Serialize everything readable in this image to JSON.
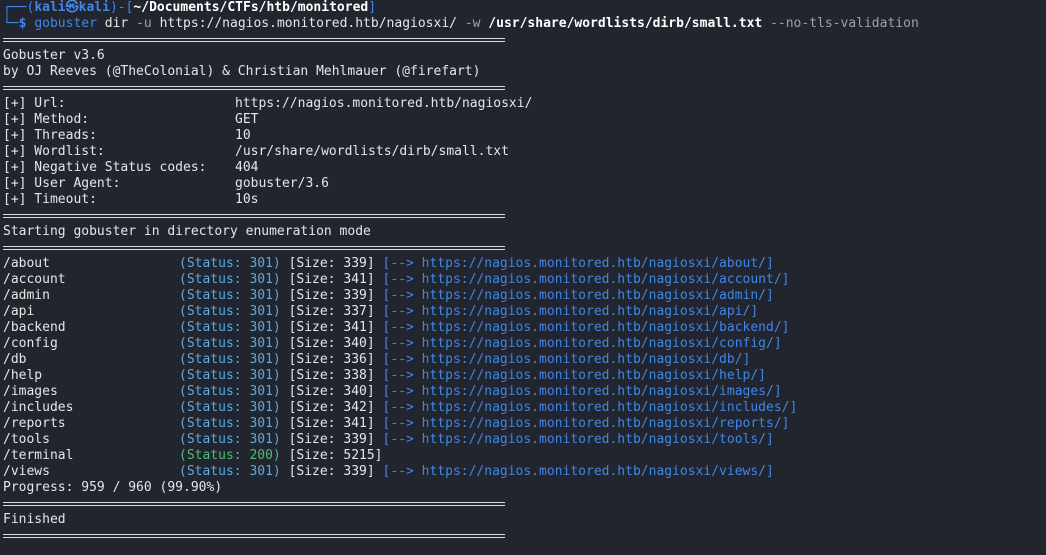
{
  "prompt": {
    "corner_top": "┌──(",
    "user": "kali㉿kali",
    "mid": ")-[",
    "cwd": "~/Documents/CTFs/htb/monitored",
    "close": "]",
    "corner_bottom": "└─",
    "dollar": "$ ",
    "cmd_tool": "gobuster",
    "cmd_sub": "dir",
    "flag_u": "-u",
    "url": "https://nagios.monitored.htb/nagiosxi/",
    "flag_w": "-w",
    "wordlist": "/usr/share/wordlists/dirb/small.txt",
    "flag_tls": "--no-tls-validation"
  },
  "banner": {
    "version": "Gobuster v3.6",
    "authors": "by OJ Reeves (@TheColonial) & Christian Mehlmauer (@firefart)"
  },
  "config": [
    {
      "key": "[+] Url:",
      "value": "https://nagios.monitored.htb/nagiosxi/"
    },
    {
      "key": "[+] Method:",
      "value": "GET"
    },
    {
      "key": "[+] Threads:",
      "value": "10"
    },
    {
      "key": "[+] Wordlist:",
      "value": "/usr/share/wordlists/dirb/small.txt"
    },
    {
      "key": "[+] Negative Status codes:",
      "value": "404"
    },
    {
      "key": "[+] User Agent:",
      "value": "gobuster/3.6"
    },
    {
      "key": "[+] Timeout:",
      "value": "10s"
    }
  ],
  "start_msg": "Starting gobuster in directory enumeration mode",
  "results": [
    {
      "path": "/about",
      "status": "(Status: 301)",
      "size": "[Size: 339]",
      "arrow": "[-->",
      "redirect": "https://nagios.monitored.htb/nagiosxi/about/]"
    },
    {
      "path": "/account",
      "status": "(Status: 301)",
      "size": "[Size: 341]",
      "arrow": "[-->",
      "redirect": "https://nagios.monitored.htb/nagiosxi/account/]"
    },
    {
      "path": "/admin",
      "status": "(Status: 301)",
      "size": "[Size: 339]",
      "arrow": "[-->",
      "redirect": "https://nagios.monitored.htb/nagiosxi/admin/]"
    },
    {
      "path": "/api",
      "status": "(Status: 301)",
      "size": "[Size: 337]",
      "arrow": "[-->",
      "redirect": "https://nagios.monitored.htb/nagiosxi/api/]"
    },
    {
      "path": "/backend",
      "status": "(Status: 301)",
      "size": "[Size: 341]",
      "arrow": "[-->",
      "redirect": "https://nagios.monitored.htb/nagiosxi/backend/]"
    },
    {
      "path": "/config",
      "status": "(Status: 301)",
      "size": "[Size: 340]",
      "arrow": "[-->",
      "redirect": "https://nagios.monitored.htb/nagiosxi/config/]"
    },
    {
      "path": "/db",
      "status": "(Status: 301)",
      "size": "[Size: 336]",
      "arrow": "[-->",
      "redirect": "https://nagios.monitored.htb/nagiosxi/db/]"
    },
    {
      "path": "/help",
      "status": "(Status: 301)",
      "size": "[Size: 338]",
      "arrow": "[-->",
      "redirect": "https://nagios.monitored.htb/nagiosxi/help/]"
    },
    {
      "path": "/images",
      "status": "(Status: 301)",
      "size": "[Size: 340]",
      "arrow": "[-->",
      "redirect": "https://nagios.monitored.htb/nagiosxi/images/]"
    },
    {
      "path": "/includes",
      "status": "(Status: 301)",
      "size": "[Size: 342]",
      "arrow": "[-->",
      "redirect": "https://nagios.monitored.htb/nagiosxi/includes/]"
    },
    {
      "path": "/reports",
      "status": "(Status: 301)",
      "size": "[Size: 341]",
      "arrow": "[-->",
      "redirect": "https://nagios.monitored.htb/nagiosxi/reports/]"
    },
    {
      "path": "/tools",
      "status": "(Status: 301)",
      "size": "[Size: 339]",
      "arrow": "[-->",
      "redirect": "https://nagios.monitored.htb/nagiosxi/tools/]"
    },
    {
      "path": "/terminal",
      "status": "(Status: 200)",
      "size": "[Size: 5215]",
      "arrow": "",
      "redirect": ""
    },
    {
      "path": "/views",
      "status": "(Status: 301)",
      "size": "[Size: 339]",
      "arrow": "[-->",
      "redirect": "https://nagios.monitored.htb/nagiosxi/views/]"
    }
  ],
  "progress": "Progress: 959 / 960 (99.90%)",
  "finished": "Finished",
  "colors": {
    "background": "#23252e",
    "prompt_blue": "#3f86e8",
    "status_301": "#5aa9e6",
    "status_200": "#4bbf73"
  }
}
